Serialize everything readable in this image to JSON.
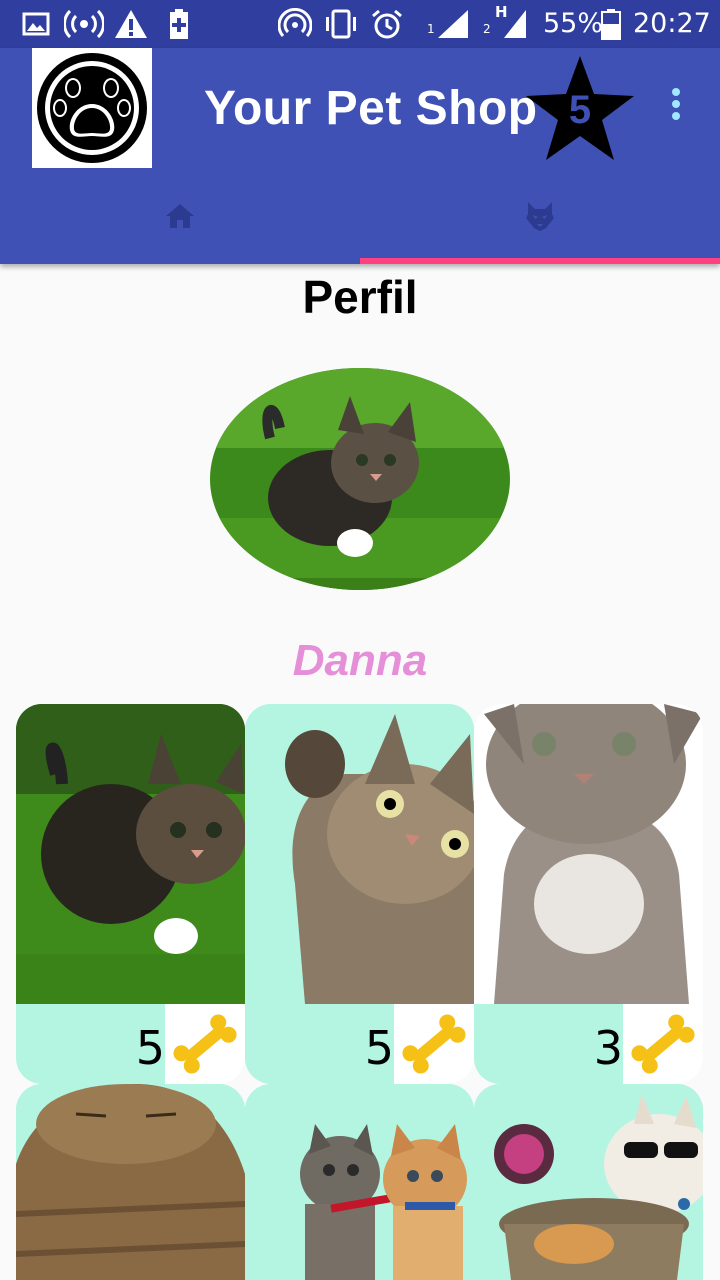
{
  "status_bar": {
    "sim1_label": "1",
    "sim2_label": "2",
    "network_type": "H",
    "battery": "55%",
    "time": "20:27",
    "icons": [
      "gallery-icon",
      "hotspot-icon",
      "warning-icon",
      "battery-plus-icon",
      "wifi-icon",
      "vibrate-icon",
      "alarm-icon",
      "signal-icon",
      "signal-icon",
      "battery-icon"
    ]
  },
  "app_bar": {
    "title": "Your Pet Shop",
    "badge_number": "5",
    "background": "#3f51b5",
    "accent": "#ff4081"
  },
  "tabs": [
    {
      "icon": "home-icon",
      "selected": false
    },
    {
      "icon": "wolf-icon",
      "selected": true
    }
  ],
  "profile": {
    "title": "Perfil",
    "name": "Danna",
    "name_color": "#e58fd8"
  },
  "cards": [
    {
      "image": "kitten-in-grass",
      "price": "5",
      "icon": "bone-icon"
    },
    {
      "image": "cat-waving-paw",
      "price": "5",
      "icon": "bone-icon"
    },
    {
      "image": "grey-tabby-kitten",
      "price": "3",
      "icon": "bone-icon"
    },
    {
      "image": "tabby-cat-eyes-closed"
    },
    {
      "image": "two-kittens-with-collars"
    },
    {
      "image": "cat-with-sunglasses-in-pot"
    }
  ]
}
